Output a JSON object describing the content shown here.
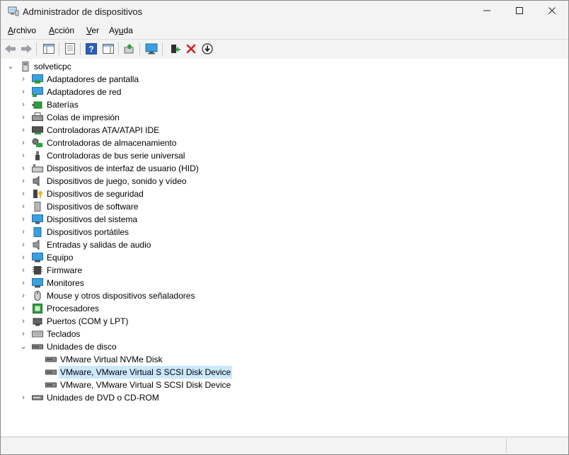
{
  "window": {
    "title": "Administrador de dispositivos"
  },
  "menu": [
    {
      "pre": "",
      "ul": "A",
      "post": "rchivo"
    },
    {
      "pre": "",
      "ul": "A",
      "post": "cción"
    },
    {
      "pre": "",
      "ul": "V",
      "post": "er"
    },
    {
      "pre": "Ay",
      "ul": "u",
      "post": "da"
    }
  ],
  "tree": {
    "root": "solveticpc",
    "categories": [
      "Adaptadores de pantalla",
      "Adaptadores de red",
      "Baterías",
      "Colas de impresión",
      "Controladoras ATA/ATAPI IDE",
      "Controladoras de almacenamiento",
      "Controladoras de bus serie universal",
      "Dispositivos de interfaz de usuario (HID)",
      "Dispositivos de juego, sonido y vídeo",
      "Dispositivos de seguridad",
      "Dispositivos de software",
      "Dispositivos del sistema",
      "Dispositivos portátiles",
      "Entradas y salidas de audio",
      "Equipo",
      "Firmware",
      "Monitores",
      "Mouse y otros dispositivos señaladores",
      "Procesadores",
      "Puertos (COM y LPT)",
      "Teclados",
      "Unidades de disco"
    ],
    "disks": [
      "VMware Virtual NVMe Disk",
      "VMware, VMware Virtual S SCSI Disk Device",
      "VMware, VMware Virtual S SCSI Disk Device"
    ],
    "last": "Unidades de DVD o CD-ROM"
  }
}
